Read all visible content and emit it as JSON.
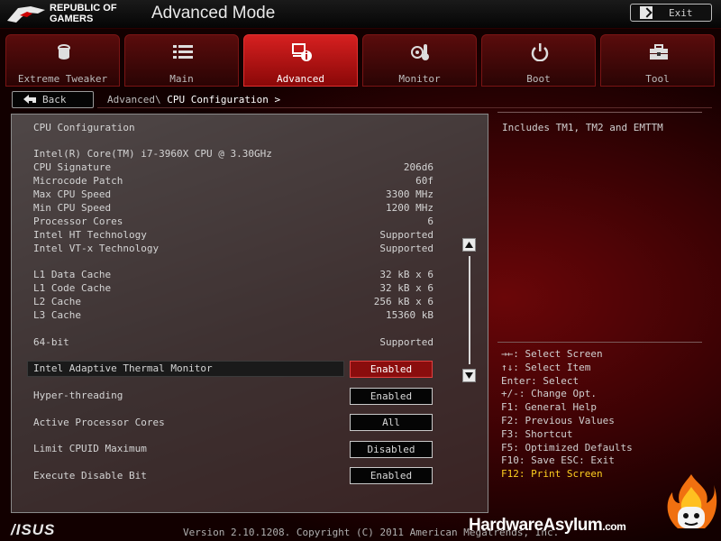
{
  "header": {
    "brand_line1": "REPUBLIC OF",
    "brand_line2": "GAMERS",
    "mode_title": "Advanced Mode",
    "exit_label": "Exit"
  },
  "tabs": [
    {
      "label": "Extreme Tweaker",
      "icon": "tweaker-icon",
      "active": false
    },
    {
      "label": "Main",
      "icon": "list-icon",
      "active": false
    },
    {
      "label": "Advanced",
      "icon": "advanced-info-icon",
      "active": true
    },
    {
      "label": "Monitor",
      "icon": "thermometer-icon",
      "active": false
    },
    {
      "label": "Boot",
      "icon": "power-icon",
      "active": false
    },
    {
      "label": "Tool",
      "icon": "toolbox-icon",
      "active": false
    }
  ],
  "nav": {
    "back_label": "Back",
    "breadcrumb_parent": "Advanced\\",
    "breadcrumb_current": "CPU Configuration >"
  },
  "panel": {
    "title": "CPU Configuration",
    "cpu_name": "Intel(R) Core(TM) i7-3960X CPU @ 3.30GHz",
    "info_rows": [
      {
        "label": "CPU Signature",
        "value": "206d6"
      },
      {
        "label": "Microcode Patch",
        "value": "60f"
      },
      {
        "label": "Max CPU Speed",
        "value": "3300 MHz"
      },
      {
        "label": "Min CPU Speed",
        "value": "1200 MHz"
      },
      {
        "label": "Processor Cores",
        "value": "6"
      },
      {
        "label": "Intel HT Technology",
        "value": "Supported"
      },
      {
        "label": "Intel VT-x Technology",
        "value": "Supported"
      },
      {
        "label": "L1 Data Cache",
        "value": "32 kB x 6"
      },
      {
        "label": "L1 Code Cache",
        "value": "32 kB x 6"
      },
      {
        "label": "L2 Cache",
        "value": "256 kB x 6"
      },
      {
        "label": "L3 Cache",
        "value": "15360 kB"
      },
      {
        "label": "64-bit",
        "value": "Supported"
      }
    ],
    "options": [
      {
        "label": "Intel Adaptive Thermal Monitor",
        "value": "Enabled",
        "selected": true
      },
      {
        "label": "Hyper-threading",
        "value": "Enabled",
        "selected": false
      },
      {
        "label": "Active Processor Cores",
        "value": "All",
        "selected": false
      },
      {
        "label": "Limit CPUID Maximum",
        "value": "Disabled",
        "selected": false
      },
      {
        "label": "Execute Disable Bit",
        "value": "Enabled",
        "selected": false
      }
    ]
  },
  "help": {
    "text": "Includes TM1, TM2 and EMTTM"
  },
  "keys": [
    {
      "text": "→←: Select Screen",
      "highlight": false
    },
    {
      "text": "↑↓: Select Item",
      "highlight": false
    },
    {
      "text": "Enter: Select",
      "highlight": false
    },
    {
      "text": "+/-: Change Opt.",
      "highlight": false
    },
    {
      "text": "F1: General Help",
      "highlight": false
    },
    {
      "text": "F2: Previous Values",
      "highlight": false
    },
    {
      "text": "F3: Shortcut",
      "highlight": false
    },
    {
      "text": "F5: Optimized Defaults",
      "highlight": false
    },
    {
      "text": "F10: Save  ESC: Exit",
      "highlight": false
    },
    {
      "text": "F12: Print Screen",
      "highlight": true
    }
  ],
  "footer": {
    "asus_logo": "/ISUS",
    "version": "Version 2.10.1208. Copyright (C) 2011 American Megatrends, Inc.",
    "watermark_main": "HardwareAsylum",
    "watermark_tld": ".com"
  },
  "colors": {
    "accent_red": "#d62020",
    "selected_value_bg": "#8a0d0d",
    "print_screen_yellow": "#ffd020"
  }
}
